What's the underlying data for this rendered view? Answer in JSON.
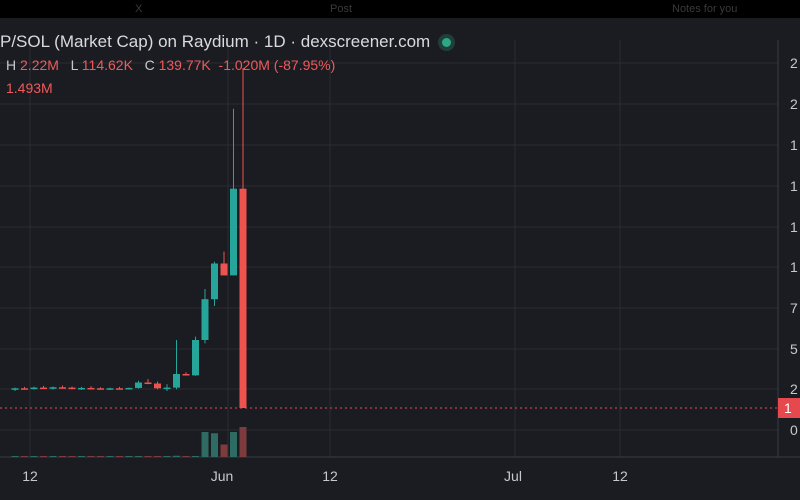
{
  "topbar": {
    "left_icon": "X",
    "center_text": "Post",
    "right_text": "Notes for you"
  },
  "header": {
    "title": "P/SOL (Market Cap) on Raydium · 1D · dexscreener.com",
    "ohlc": {
      "h_label": "H",
      "h_value": "2.22M",
      "l_label": "L",
      "l_value": "114.62K",
      "c_label": "C",
      "c_value": "139.77K",
      "change": "-1.020M (-87.95%)"
    },
    "volume": "1.493M"
  },
  "price_tag": "1",
  "colors": {
    "up": "#26a69a",
    "down": "#ef5350",
    "background": "#1b1c22",
    "grid": "#2a2c33",
    "price_line": "#e5484d"
  },
  "chart_data": {
    "type": "candlestick",
    "title": "P/SOL (Market Cap) on Raydium · 1D · dexscreener.com",
    "x_ticks": [
      "12",
      "Jun",
      "12",
      "Jul",
      "12"
    ],
    "y_ticks": [
      "2",
      "2",
      "1",
      "1",
      "1",
      "1",
      "7",
      "5",
      "2",
      "0"
    ],
    "candles": [
      {
        "o": 0.55,
        "h": 0.6,
        "l": 0.5,
        "c": 0.58
      },
      {
        "o": 0.58,
        "h": 0.62,
        "l": 0.55,
        "c": 0.57
      },
      {
        "o": 0.57,
        "h": 0.63,
        "l": 0.54,
        "c": 0.6
      },
      {
        "o": 0.6,
        "h": 0.65,
        "l": 0.56,
        "c": 0.58
      },
      {
        "o": 0.58,
        "h": 0.63,
        "l": 0.54,
        "c": 0.61
      },
      {
        "o": 0.61,
        "h": 0.66,
        "l": 0.58,
        "c": 0.6
      },
      {
        "o": 0.6,
        "h": 0.63,
        "l": 0.55,
        "c": 0.57
      },
      {
        "o": 0.57,
        "h": 0.62,
        "l": 0.53,
        "c": 0.59
      },
      {
        "o": 0.59,
        "h": 0.64,
        "l": 0.56,
        "c": 0.58
      },
      {
        "o": 0.58,
        "h": 0.61,
        "l": 0.54,
        "c": 0.56
      },
      {
        "o": 0.56,
        "h": 0.6,
        "l": 0.53,
        "c": 0.58
      },
      {
        "o": 0.58,
        "h": 0.62,
        "l": 0.55,
        "c": 0.57
      },
      {
        "o": 0.57,
        "h": 0.6,
        "l": 0.54,
        "c": 0.59
      },
      {
        "o": 0.59,
        "h": 0.8,
        "l": 0.57,
        "c": 0.75
      },
      {
        "o": 0.75,
        "h": 0.85,
        "l": 0.7,
        "c": 0.72
      },
      {
        "o": 0.72,
        "h": 0.78,
        "l": 0.55,
        "c": 0.58
      },
      {
        "o": 0.58,
        "h": 0.7,
        "l": 0.5,
        "c": 0.6
      },
      {
        "o": 0.6,
        "h": 2.0,
        "l": 0.55,
        "c": 1.0
      },
      {
        "o": 1.0,
        "h": 1.05,
        "l": 0.96,
        "c": 0.96
      },
      {
        "o": 0.96,
        "h": 2.1,
        "l": 0.95,
        "c": 2.0
      },
      {
        "o": 2.0,
        "h": 3.5,
        "l": 1.9,
        "c": 3.2
      },
      {
        "o": 3.2,
        "h": 4.3,
        "l": 3.0,
        "c": 4.25
      },
      {
        "o": 4.25,
        "h": 4.6,
        "l": 3.9,
        "c": 3.9
      },
      {
        "o": 3.9,
        "h": 8.8,
        "l": 3.9,
        "c": 6.45
      },
      {
        "o": 6.45,
        "h": 10.0,
        "l": 0.0,
        "c": 0.0
      }
    ],
    "volumes": [
      0.02,
      0.02,
      0.02,
      0.02,
      0.02,
      0.02,
      0.02,
      0.02,
      0.02,
      0.02,
      0.02,
      0.02,
      0.02,
      0.02,
      0.02,
      0.02,
      0.02,
      0.05,
      0.03,
      0.03,
      1.0,
      0.95,
      0.5,
      1.0,
      1.2
    ],
    "ylim": [
      0.0,
      10.0
    ],
    "price_line": 0.0
  }
}
